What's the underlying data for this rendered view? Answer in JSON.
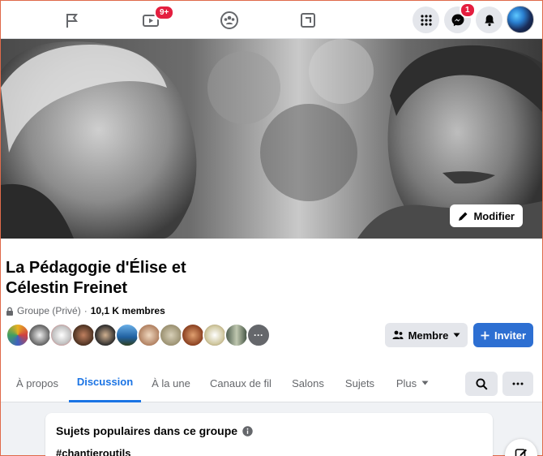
{
  "topnav": {
    "icons": [
      "flag-icon",
      "video-icon",
      "groups-icon",
      "gaming-icon"
    ],
    "video_badge": "9+",
    "messenger_badge": "1"
  },
  "cover": {
    "edit_label": "Modifier"
  },
  "group": {
    "name": "La Pédagogie d'Élise et Célestin Freinet",
    "privacy": "Groupe (Privé)",
    "separator": "·",
    "members": "10,1 K membres",
    "member_label": "Membre",
    "invite_label": "Inviter",
    "more_members_indicator": "···"
  },
  "tabs": [
    "À propos",
    "Discussion",
    "À la une",
    "Canaux de fil",
    "Salons",
    "Sujets",
    "Plus"
  ],
  "active_tab": "Discussion",
  "popular": {
    "title": "Sujets populaires dans ce groupe",
    "first_tag": "#chantieroutils"
  },
  "colors": {
    "accent": "#1b74e4",
    "invite_button": "#2d6fd2",
    "badge": "#e41e3f"
  }
}
